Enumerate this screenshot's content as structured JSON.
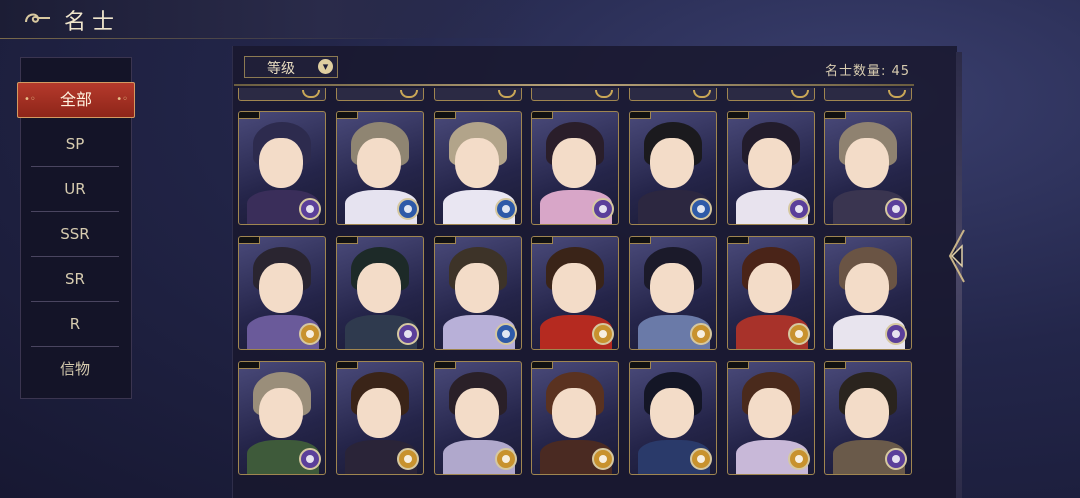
{
  "header": {
    "title": "名士",
    "back_icon": "cloud-swirl-icon"
  },
  "sidebar": {
    "items": [
      {
        "label": "全部",
        "active": true
      },
      {
        "label": "SP"
      },
      {
        "label": "UR"
      },
      {
        "label": "SSR"
      },
      {
        "label": "SR"
      },
      {
        "label": "R"
      },
      {
        "label": "信物"
      }
    ]
  },
  "toolbar": {
    "sort_label": "等级",
    "sort_icon": "chevron-down-icon",
    "count_text": "名士数量: 45"
  },
  "colors": {
    "accent_red": "#a52e21",
    "gold": "#c9a757",
    "badge_purple": "#5b3f9a",
    "badge_gold": "#c8922e",
    "badge_blue": "#2e5aa8"
  },
  "cards": [
    {
      "badge": "purple",
      "hair": "#2d2b4e",
      "robe": "#3a2e5a"
    },
    {
      "badge": "blue",
      "hair": "#8f8572",
      "robe": "#e6e3f0"
    },
    {
      "badge": "blue",
      "hair": "#b2a48a",
      "robe": "#e9e6f2"
    },
    {
      "badge": "purple",
      "hair": "#2a1e2a",
      "robe": "#d8a6c8"
    },
    {
      "badge": "blue",
      "hair": "#1b1a1e",
      "robe": "#2c2740"
    },
    {
      "badge": "purple",
      "hair": "#221c2c",
      "robe": "#e8e3ee"
    },
    {
      "badge": "purple",
      "hair": "#8f8270",
      "robe": "#3a3550"
    },
    {
      "badge": "gold",
      "hair": "#2a2530",
      "robe": "#6a5a9a"
    },
    {
      "badge": "purple",
      "hair": "#1d2a28",
      "robe": "#2f3a4e"
    },
    {
      "badge": "blue",
      "hair": "#3d3328",
      "robe": "#b8b0d8"
    },
    {
      "badge": "gold",
      "hair": "#3a2418",
      "robe": "#b52a20"
    },
    {
      "badge": "gold",
      "hair": "#1b1a2a",
      "robe": "#6a7aa8"
    },
    {
      "badge": "gold",
      "hair": "#4a2418",
      "robe": "#a8322a"
    },
    {
      "badge": "purple",
      "hair": "#6a5444",
      "robe": "#e8e4ee"
    },
    {
      "badge": "purple",
      "hair": "#9a8e7a",
      "robe": "#3e5a3a"
    },
    {
      "badge": "gold",
      "hair": "#3a2418",
      "robe": "#2a2438"
    },
    {
      "badge": "gold",
      "hair": "#2a2028",
      "robe": "#b0a8cc"
    },
    {
      "badge": "gold",
      "hair": "#5a3220",
      "robe": "#4a2a22"
    },
    {
      "badge": "gold",
      "hair": "#141626",
      "robe": "#2a3a6a"
    },
    {
      "badge": "gold",
      "hair": "#4a2a1c",
      "robe": "#c8b8d8"
    },
    {
      "badge": "purple",
      "hair": "#2a241e",
      "robe": "#6a5a4a"
    }
  ]
}
